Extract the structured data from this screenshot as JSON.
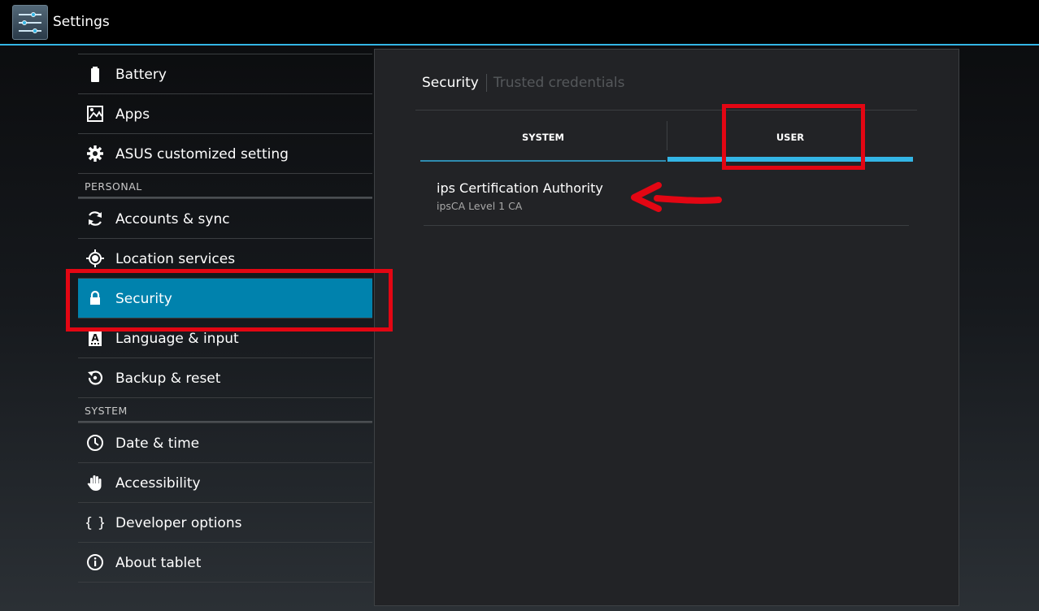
{
  "actionbar": {
    "title": "Settings",
    "icon": "settings-sliders-icon"
  },
  "sidebar": {
    "items_top": [
      {
        "label": "Battery",
        "icon": "battery-icon"
      },
      {
        "label": "Apps",
        "icon": "apps-icon"
      },
      {
        "label": "ASUS customized setting",
        "icon": "gear-icon"
      }
    ],
    "header_personal": "PERSONAL",
    "items_personal": [
      {
        "label": "Accounts & sync",
        "icon": "sync-icon"
      },
      {
        "label": "Location services",
        "icon": "location-icon"
      },
      {
        "label": "Security",
        "icon": "lock-icon",
        "selected": true
      },
      {
        "label": "Language & input",
        "icon": "keyboard-letter-icon"
      },
      {
        "label": "Backup & reset",
        "icon": "backup-icon"
      }
    ],
    "header_system": "SYSTEM",
    "items_system": [
      {
        "label": "Date & time",
        "icon": "clock-icon"
      },
      {
        "label": "Accessibility",
        "icon": "hand-icon"
      },
      {
        "label": "Developer options",
        "icon": "braces-icon"
      },
      {
        "label": "About tablet",
        "icon": "info-icon"
      }
    ]
  },
  "panel": {
    "breadcrumb_current": "Security",
    "breadcrumb_next": "Trusted credentials",
    "tabs": [
      {
        "label": "SYSTEM",
        "selected": false
      },
      {
        "label": "USER",
        "selected": true
      }
    ],
    "certificate": {
      "title": "ips Certification Authority",
      "subtitle": "ipsCA Level 1 CA"
    }
  },
  "colors": {
    "accent": "#33b5e5",
    "selected_item": "#0082ad",
    "annotation": "#e30613"
  }
}
